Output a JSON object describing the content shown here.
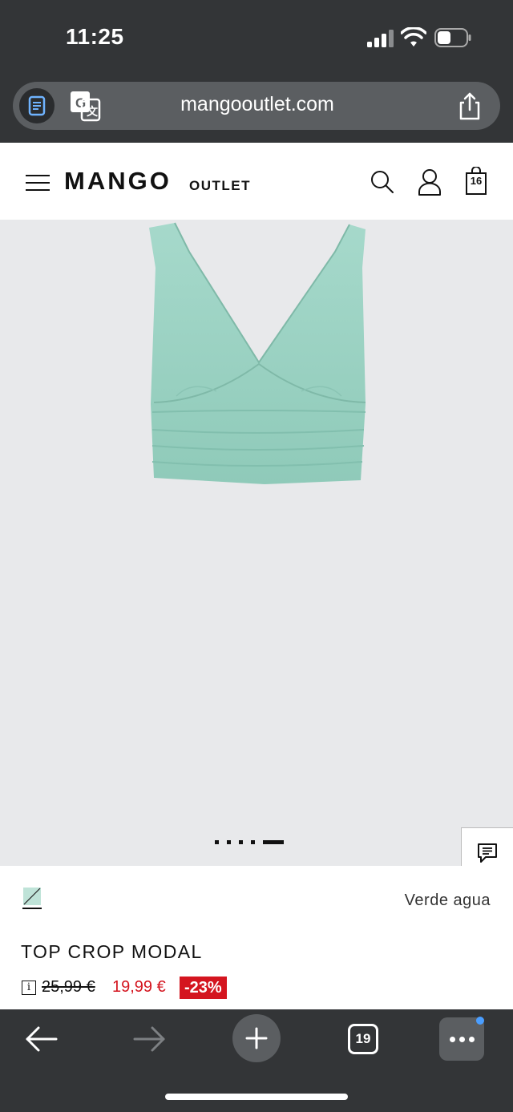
{
  "status_bar": {
    "time": "11:25",
    "icons": [
      "signal-icon",
      "wifi-icon",
      "battery-icon"
    ]
  },
  "browser": {
    "url": "mangooutlet.com",
    "icons": [
      "reader-icon",
      "translate-icon",
      "share-icon"
    ]
  },
  "site_header": {
    "logo": "MANGO",
    "logo_sub": "OUTLET",
    "bag_count": "16",
    "icons": [
      "menu-icon",
      "search-icon",
      "account-icon",
      "bag-icon"
    ]
  },
  "gallery": {
    "image_count": 5,
    "active_index": 4,
    "product_color": "#9ed3c5",
    "background": "#e8e9eb"
  },
  "product": {
    "color_name": "Verde agua",
    "title": "TOP CROP MODAL",
    "info_icon_label": "i",
    "old_price": "25,99 €",
    "new_price": "19,99 €",
    "discount": "-23%",
    "price_color": "#d4151f"
  },
  "toolbar": {
    "tab_count": "19",
    "icons": [
      "back-icon",
      "forward-icon",
      "plus-icon",
      "tabs-icon",
      "more-icon"
    ]
  }
}
